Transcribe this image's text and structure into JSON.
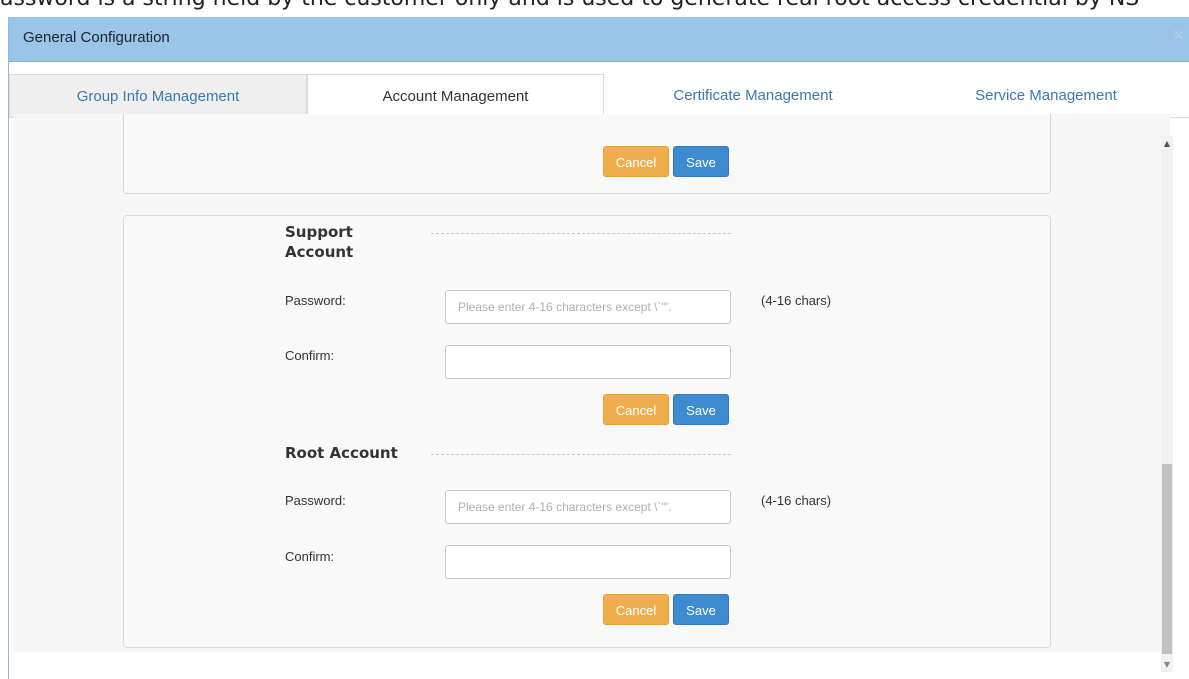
{
  "background": {
    "text": "assword is a string held by the customer only and is used to generate real root access credential by NS"
  },
  "dialog": {
    "title": "General Configuration",
    "close_glyph": "×"
  },
  "tabs": [
    {
      "label": "Group Info Management",
      "state": "inactive"
    },
    {
      "label": "Account Management",
      "state": "active"
    },
    {
      "label": "Certificate Management",
      "state": "plain"
    },
    {
      "label": "Service Management",
      "state": "plain"
    }
  ],
  "top_panel": {
    "cancel_label": "Cancel",
    "save_label": "Save"
  },
  "support_account": {
    "heading": "Support Account",
    "password_label": "Password:",
    "password_placeholder": "Please enter 4-16 characters except \\`'\".",
    "password_hint": "(4-16 chars)",
    "confirm_label": "Confirm:",
    "cancel_label": "Cancel",
    "save_label": "Save"
  },
  "root_account": {
    "heading": "Root Account",
    "password_label": "Password:",
    "password_placeholder": "Please enter 4-16 characters except \\`'\".",
    "password_hint": "(4-16 chars)",
    "confirm_label": "Confirm:",
    "cancel_label": "Cancel",
    "save_label": "Save"
  },
  "scrollbar": {
    "up_glyph": "▲",
    "down_glyph": "▼"
  },
  "colors": {
    "titlebar": "#99c5e6",
    "cancel": "#f0ad4e",
    "save": "#3d8bd0",
    "tab_link": "#3a78b5"
  }
}
